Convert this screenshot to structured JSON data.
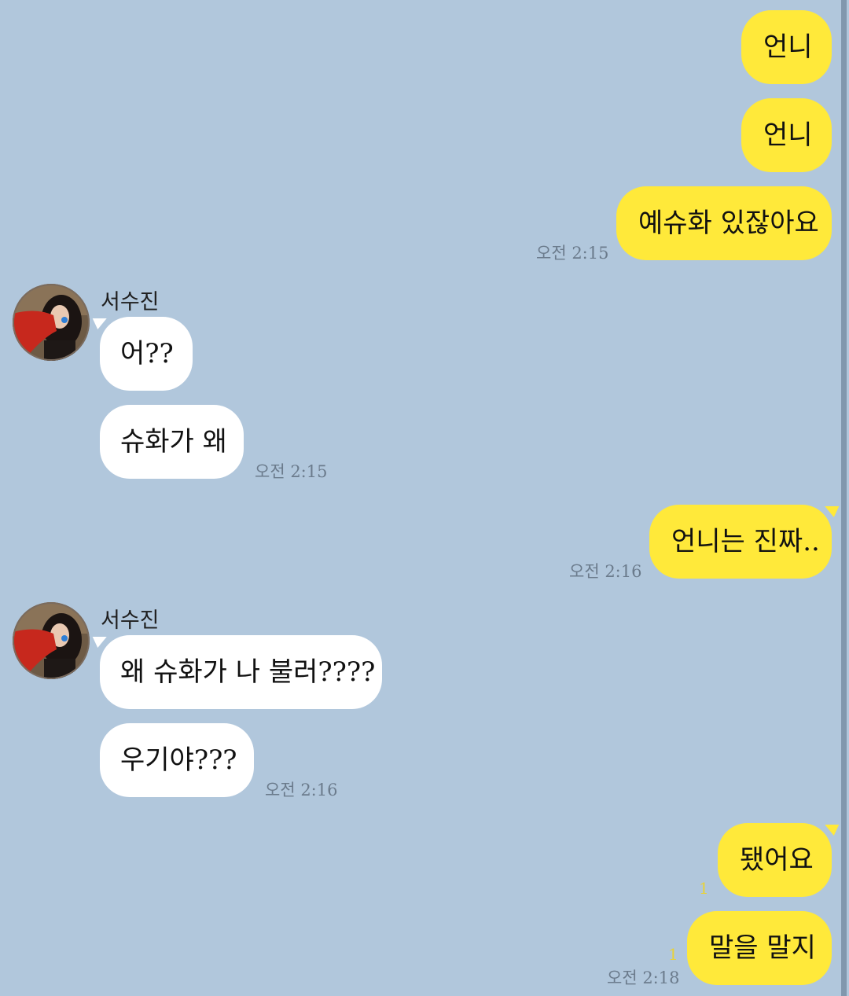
{
  "messages": [
    {
      "id": "m1",
      "side": "out",
      "text": "언니"
    },
    {
      "id": "m2",
      "side": "out",
      "text": "언니"
    },
    {
      "id": "m3",
      "side": "out",
      "text": "예슈화 있잖아요",
      "time": "오전 2:15"
    },
    {
      "id": "m4",
      "side": "in",
      "sender": "서수진",
      "text": "어??"
    },
    {
      "id": "m5",
      "side": "in",
      "text": "슈화가 왜",
      "time": "오전 2:15"
    },
    {
      "id": "m6",
      "side": "out",
      "text": "언니는 진짜..",
      "time": "오전 2:16"
    },
    {
      "id": "m7",
      "side": "in",
      "sender": "서수진",
      "text": "왜 슈화가 나 불러????"
    },
    {
      "id": "m8",
      "side": "in",
      "text": "우기야???",
      "time": "오전 2:16"
    },
    {
      "id": "m9",
      "side": "out",
      "text": "됐어요",
      "unread": "1"
    },
    {
      "id": "m10",
      "side": "out",
      "text": "말을 말지",
      "unread": "1",
      "time": "오전 2:18"
    }
  ],
  "colors": {
    "background": "#b1c7dc",
    "outgoing_bubble": "#ffe93a",
    "incoming_bubble": "#ffffff",
    "timestamp": "#6b7b8c",
    "unread_count": "#e8d23a"
  },
  "icons": {
    "avatar": "profile-photo"
  }
}
